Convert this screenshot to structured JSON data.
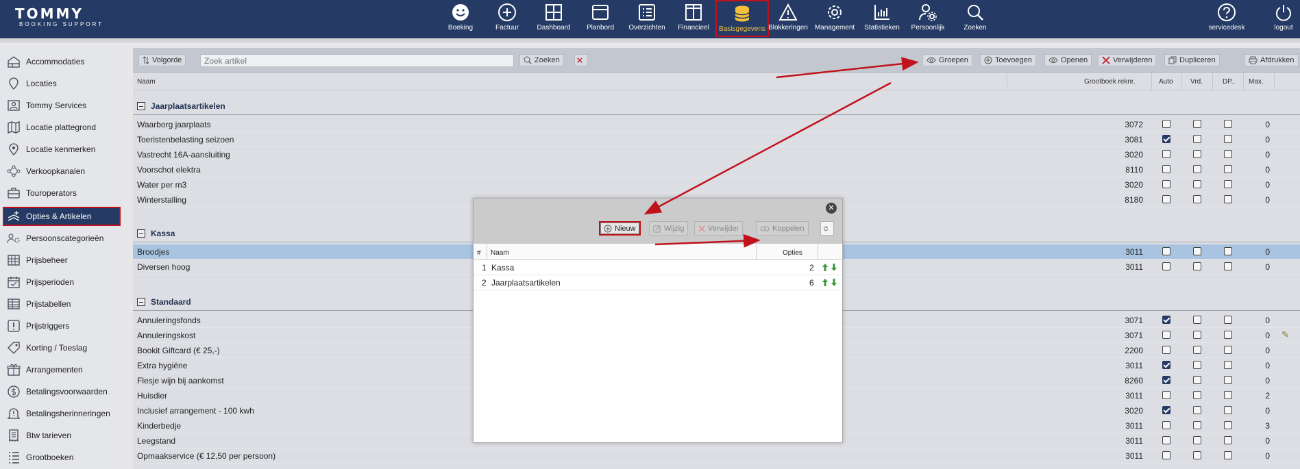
{
  "app": {
    "logo_line1": "TOMMY",
    "logo_line2": "BOOKING SUPPORT"
  },
  "nav": [
    {
      "label": "Boeking",
      "icon": "smiley-icon"
    },
    {
      "label": "Factuur",
      "icon": "plus-circle-icon"
    },
    {
      "label": "Dashboard",
      "icon": "grid-icon"
    },
    {
      "label": "Planbord",
      "icon": "board-icon"
    },
    {
      "label": "Overzichten",
      "icon": "list-icon"
    },
    {
      "label": "Financieel",
      "icon": "columns-icon"
    },
    {
      "label": "Basisgegevens",
      "icon": "database-icon",
      "active": true
    },
    {
      "label": "Blokkeringen",
      "icon": "warning-icon"
    },
    {
      "label": "Management",
      "icon": "gear-icon"
    },
    {
      "label": "Statistieken",
      "icon": "bar-chart-icon"
    },
    {
      "label": "Persoonlijk",
      "icon": "user-gear-icon"
    },
    {
      "label": "Zoeken",
      "icon": "search-icon"
    }
  ],
  "nav_right": [
    {
      "label": "servicedesk",
      "icon": "help-icon"
    },
    {
      "label": "logout",
      "icon": "power-icon"
    }
  ],
  "sidebar": {
    "items": [
      {
        "label": "Accommodaties",
        "icon": "house-icon"
      },
      {
        "label": "Locaties",
        "icon": "pin-icon"
      },
      {
        "label": "Tommy Services",
        "icon": "person-card-icon"
      },
      {
        "label": "Locatie plattegrond",
        "icon": "map-icon"
      },
      {
        "label": "Locatie kenmerken",
        "icon": "pin-star-icon"
      },
      {
        "label": "Verkoopkanalen",
        "icon": "network-icon"
      },
      {
        "label": "Touroperators",
        "icon": "suitcase-icon"
      },
      {
        "label": "Opties & Artikelen",
        "icon": "options-icon",
        "active": true
      },
      {
        "label": "Persoonscategorieën",
        "icon": "users-gear-icon"
      },
      {
        "label": "Prijsbeheer",
        "icon": "prices-icon"
      },
      {
        "label": "Prijsperioden",
        "icon": "calendar-icon"
      },
      {
        "label": "Prijstabellen",
        "icon": "table-icon"
      },
      {
        "label": "Prijstriggers",
        "icon": "trigger-icon"
      },
      {
        "label": "Korting / Toeslag",
        "icon": "tag-icon"
      },
      {
        "label": "Arrangementen",
        "icon": "gift-icon"
      },
      {
        "label": "Betalingsvoorwaarden",
        "icon": "coin-icon"
      },
      {
        "label": "Betalingsherinneringen",
        "icon": "bell-icon"
      },
      {
        "label": "Btw tarieven",
        "icon": "receipt-icon"
      },
      {
        "label": "Grootboeken",
        "icon": "ledger-icon"
      }
    ]
  },
  "toolbar": {
    "volgorde": "Volgorde",
    "search_placeholder": "Zoek artikel",
    "zoeken": "Zoeken",
    "groepen": "Groepen",
    "toevoegen": "Toevoegen",
    "openen": "Openen",
    "verwijderen": "Verwijderen",
    "dupliceren": "Dupliceren",
    "afdrukken": "Afdrukken"
  },
  "columns": {
    "naam": "Naam",
    "grootboek": "Grootboek reknr.",
    "auto": "Auto",
    "vrd": "Vrd.",
    "dp": "DP..",
    "max": "Max."
  },
  "groups": [
    {
      "title": "Jaarplaatsartikelen",
      "rows": [
        {
          "name": "Waarborg jaarplaats",
          "gb": "3072",
          "auto": false,
          "vrd": false,
          "dp": false,
          "max": "0"
        },
        {
          "name": "Toeristenbelasting seizoen",
          "gb": "3081",
          "auto": true,
          "vrd": false,
          "dp": false,
          "max": "0"
        },
        {
          "name": "Vastrecht 16A-aansluiting",
          "gb": "3020",
          "auto": false,
          "vrd": false,
          "dp": false,
          "max": "0"
        },
        {
          "name": "Voorschot elektra",
          "gb": "8110",
          "auto": false,
          "vrd": false,
          "dp": false,
          "max": "0"
        },
        {
          "name": "Water per m3",
          "gb": "3020",
          "auto": false,
          "vrd": false,
          "dp": false,
          "max": "0"
        },
        {
          "name": "Winterstalling",
          "gb": "8180",
          "auto": false,
          "vrd": false,
          "dp": false,
          "max": "0"
        }
      ]
    },
    {
      "title": "Kassa",
      "rows": [
        {
          "name": "Broodjes",
          "gb": "3011",
          "auto": false,
          "vrd": false,
          "dp": false,
          "max": "0",
          "selected": true
        },
        {
          "name": "Diversen hoog",
          "gb": "3011",
          "auto": false,
          "vrd": false,
          "dp": false,
          "max": "0"
        }
      ]
    },
    {
      "title": "Standaard",
      "rows": [
        {
          "name": "Annuleringsfonds",
          "gb": "3071",
          "auto": true,
          "vrd": false,
          "dp": false,
          "max": "0"
        },
        {
          "name": "Annuleringskost",
          "gb": "3071",
          "auto": false,
          "vrd": false,
          "dp": false,
          "max": "0"
        },
        {
          "name": "Bookit Giftcard (€ 25,-)",
          "gb": "2200",
          "auto": false,
          "vrd": false,
          "dp": false,
          "max": "0"
        },
        {
          "name": "Extra hygiëne",
          "gb": "3011",
          "auto": true,
          "vrd": false,
          "dp": false,
          "max": "0"
        },
        {
          "name": "Flesje wijn bij aankomst",
          "gb": "8260",
          "auto": true,
          "vrd": false,
          "dp": false,
          "max": "0"
        },
        {
          "name": "Huisdier",
          "gb": "3011",
          "auto": false,
          "vrd": false,
          "dp": false,
          "max": "2"
        },
        {
          "name": "Inclusief arrangement - 100 kwh",
          "gb": "3020",
          "auto": true,
          "vrd": false,
          "dp": false,
          "max": "0"
        },
        {
          "name": "Kinderbedje",
          "gb": "3011",
          "auto": false,
          "vrd": false,
          "dp": false,
          "max": "3"
        },
        {
          "name": "Leegstand",
          "gb": "3011",
          "auto": false,
          "vrd": false,
          "dp": false,
          "max": "0"
        },
        {
          "name": "Opmaakservice (€ 12,50 per persoon)",
          "gb": "3011",
          "auto": false,
          "vrd": false,
          "dp": false,
          "max": "0"
        }
      ]
    }
  ],
  "modal": {
    "buttons": {
      "nieuw": "Nieuw",
      "wijzig": "Wijzig",
      "verwijder": "Verwijder",
      "koppelen": "Koppelen"
    },
    "columns": {
      "num": "#",
      "naam": "Naam",
      "opties": "Opties"
    },
    "rows": [
      {
        "num": "1",
        "name": "Kassa",
        "opties": "2"
      },
      {
        "num": "2",
        "name": "Jaarplaatsartikelen",
        "opties": "6"
      }
    ]
  },
  "colors": {
    "nav_bg": "#253a64",
    "highlight": "#c0121c",
    "active_text": "#f3c23a",
    "selected_row": "#a8c4e0"
  }
}
